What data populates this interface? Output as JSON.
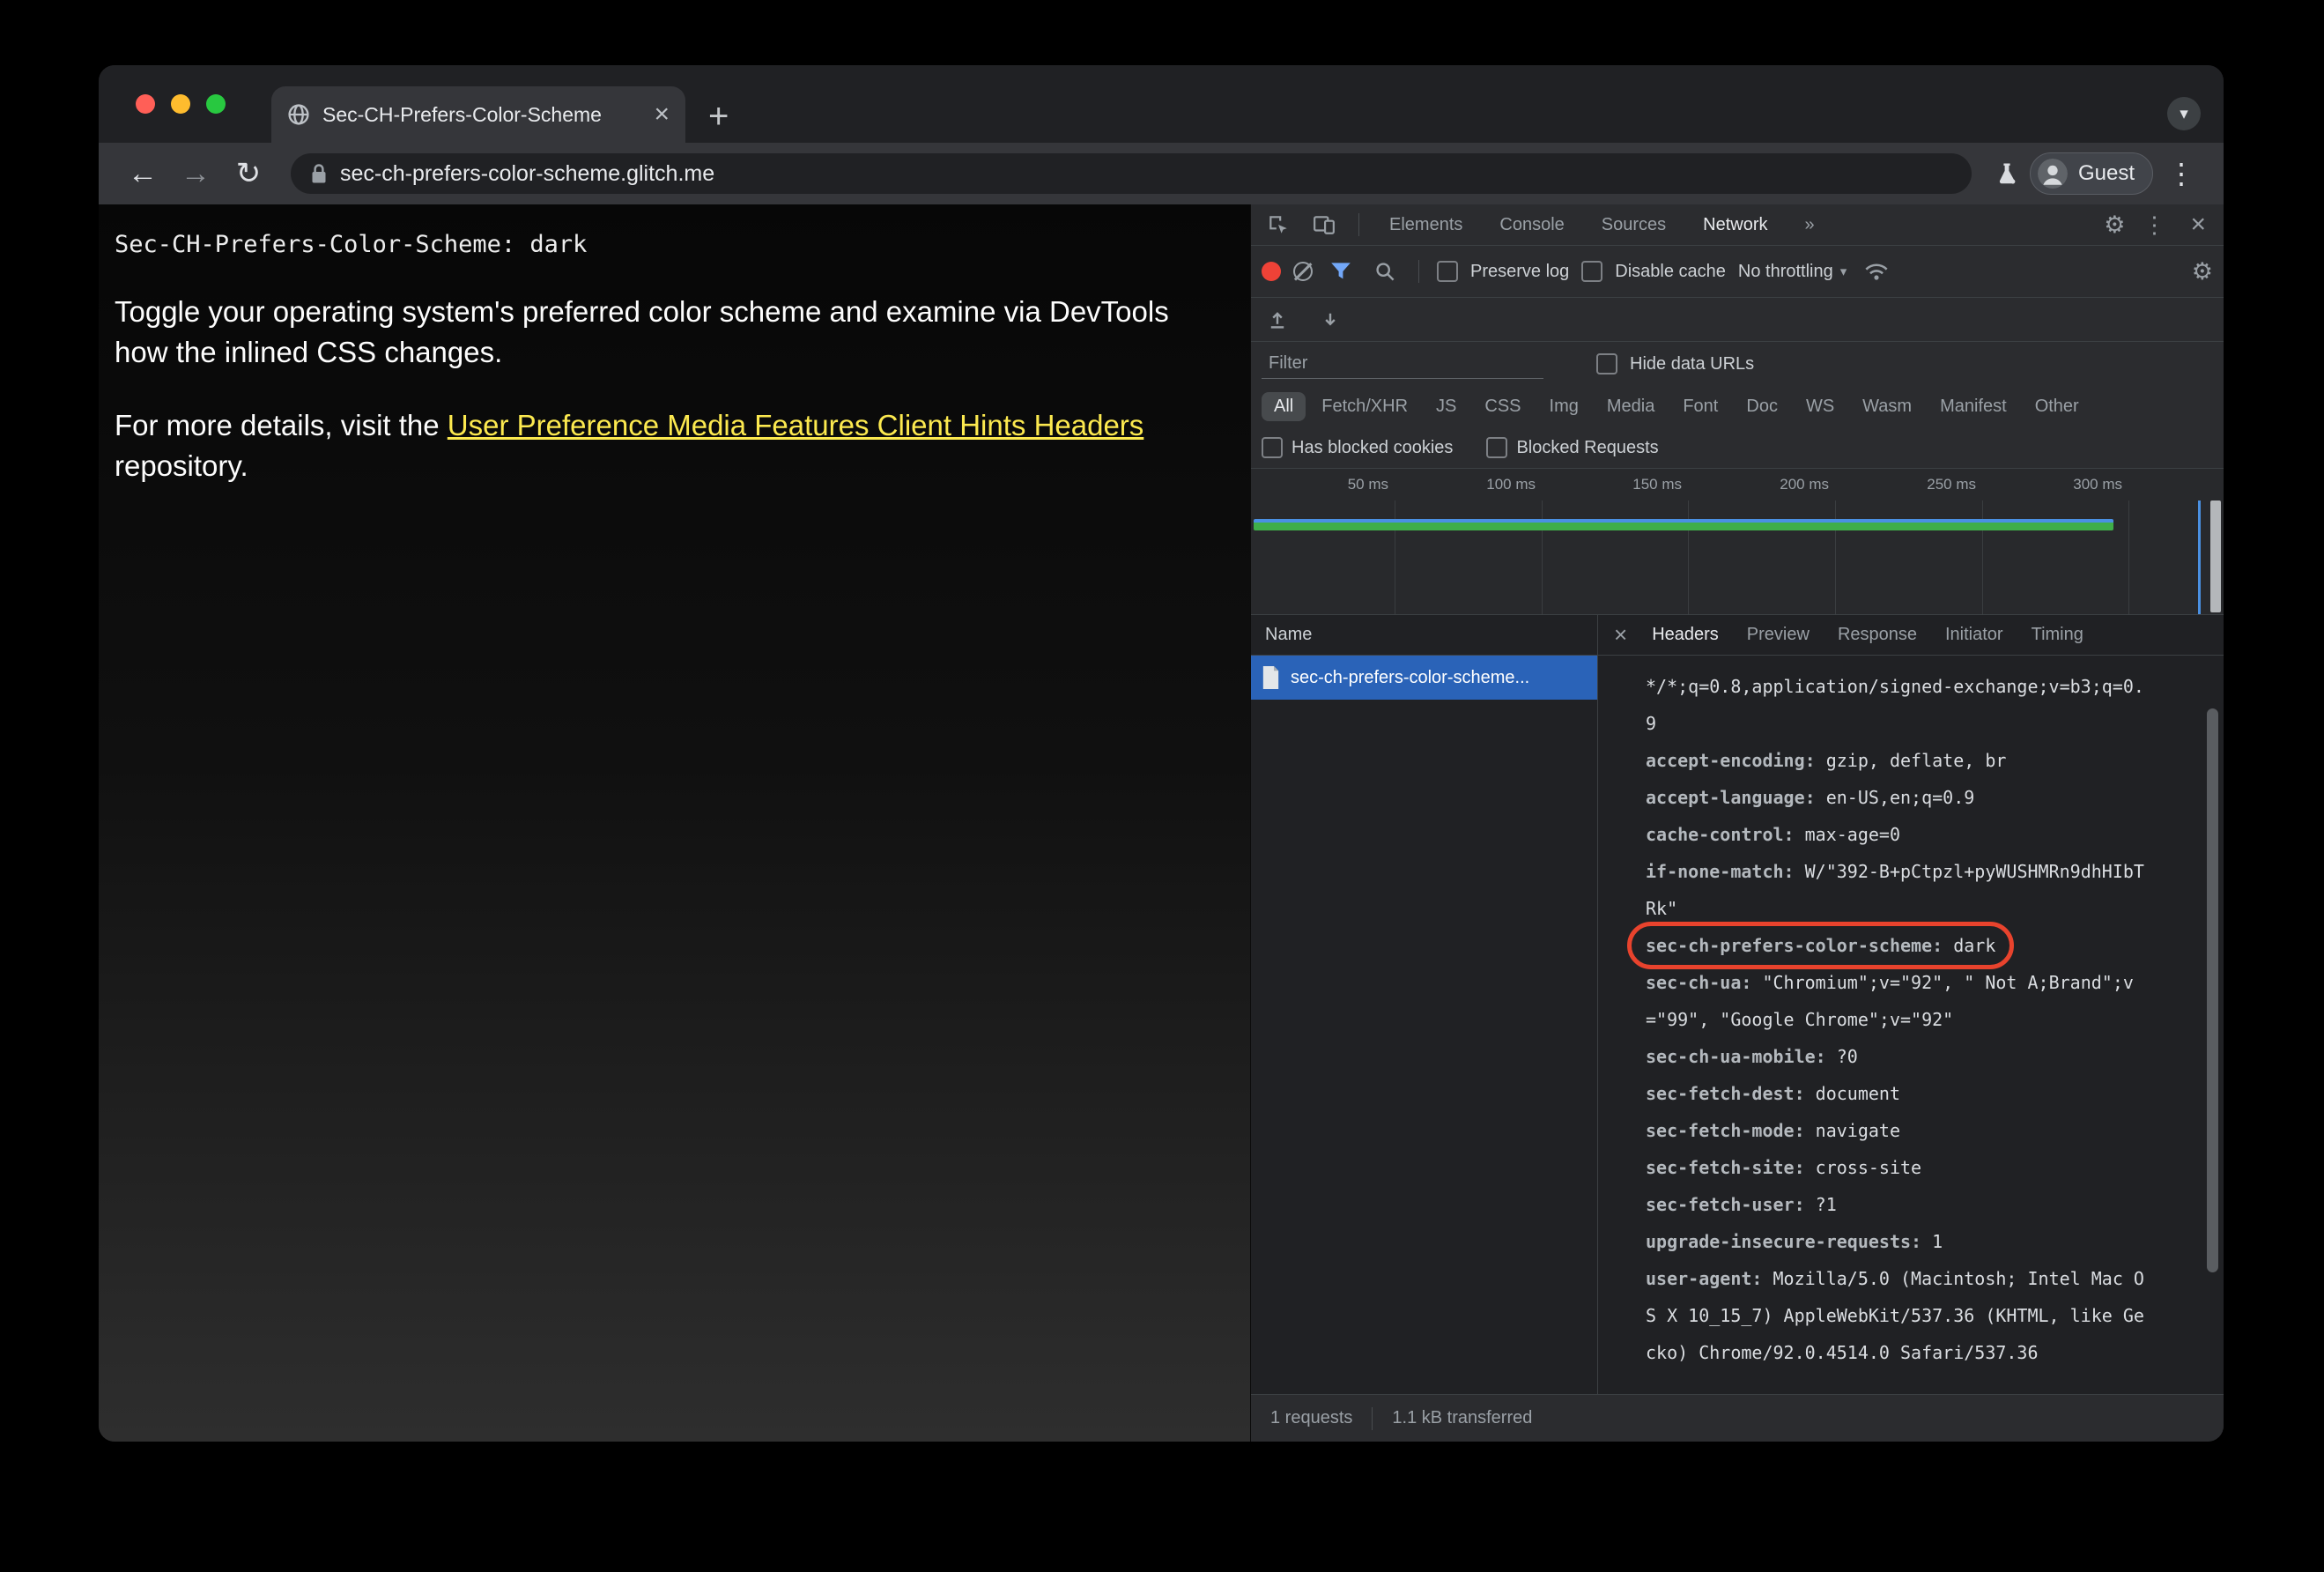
{
  "colors": {
    "accent_blue": "#8ab4f8",
    "record_red": "#ef4237",
    "annotation_red": "#e8432d",
    "link_yellow": "#fce94f",
    "selected_row_blue": "#2a63b8",
    "timeline_green": "#3fae49",
    "timeline_blue": "#4a90e2"
  },
  "browser": {
    "tab_title": "Sec-CH-Prefers-Color-Scheme",
    "tab_close": "×",
    "new_tab": "+",
    "tab_menu_chevron": "▾",
    "back": "←",
    "forward": "→",
    "reload": "↻",
    "url": "sec-ch-prefers-color-scheme.glitch.me",
    "guest_label": "Guest",
    "kebab": "⋮"
  },
  "page": {
    "mono_header": "Sec-CH-Prefers-Color-Scheme: dark",
    "para1": "Toggle your operating system's preferred color scheme and examine via DevTools how the inlined CSS changes.",
    "para2_prefix": "For more details, visit the ",
    "para2_link": "User Preference Media Features Client Hints Headers",
    "para2_suffix": " repository."
  },
  "devtools": {
    "tabs": [
      "Elements",
      "Console",
      "Sources",
      "Network"
    ],
    "overflow": "»",
    "gear": "⚙",
    "kebab": "⋮",
    "close": "×",
    "toolbar": {
      "preserve_log": "Preserve log",
      "disable_cache": "Disable cache",
      "throttling": "No throttling",
      "throttle_chevron": "▾"
    },
    "filter": {
      "placeholder": "Filter",
      "hide_data_urls": "Hide data URLs"
    },
    "chips": [
      "All",
      "Fetch/XHR",
      "JS",
      "CSS",
      "Img",
      "Media",
      "Font",
      "Doc",
      "WS",
      "Wasm",
      "Manifest",
      "Other"
    ],
    "blocked": {
      "cookies": "Has blocked cookies",
      "requests": "Blocked Requests"
    },
    "timeline_ticks": [
      "50 ms",
      "100 ms",
      "150 ms",
      "200 ms",
      "250 ms",
      "300 ms"
    ],
    "requests": {
      "name_header": "Name",
      "rows": [
        {
          "name": "sec-ch-prefers-color-scheme..."
        }
      ]
    },
    "details": {
      "close": "×",
      "tabs": [
        "Headers",
        "Preview",
        "Response",
        "Initiator",
        "Timing"
      ]
    },
    "headers_list": [
      {
        "name": "",
        "value": "*/*;q=0.8,application/signed-exchange;v=b3;q=0.9"
      },
      {
        "name": "accept-encoding:",
        "value": "gzip, deflate, br"
      },
      {
        "name": "accept-language:",
        "value": "en-US,en;q=0.9"
      },
      {
        "name": "cache-control:",
        "value": "max-age=0"
      },
      {
        "name": "if-none-match:",
        "value": "W/\"392-B+pCtpzl+pyWUSHMRn9dhHIbTRk\""
      },
      {
        "name": "sec-ch-prefers-color-scheme:",
        "value": "dark"
      },
      {
        "name": "sec-ch-ua:",
        "value": "\"Chromium\";v=\"92\", \" Not A;Brand\";v=\"99\", \"Google Chrome\";v=\"92\""
      },
      {
        "name": "sec-ch-ua-mobile:",
        "value": "?0"
      },
      {
        "name": "sec-fetch-dest:",
        "value": "document"
      },
      {
        "name": "sec-fetch-mode:",
        "value": "navigate"
      },
      {
        "name": "sec-fetch-site:",
        "value": "cross-site"
      },
      {
        "name": "sec-fetch-user:",
        "value": "?1"
      },
      {
        "name": "upgrade-insecure-requests:",
        "value": "1"
      },
      {
        "name": "user-agent:",
        "value": "Mozilla/5.0 (Macintosh; Intel Mac OS X 10_15_7) AppleWebKit/537.36 (KHTML, like Gecko) Chrome/92.0.4514.0 Safari/537.36"
      }
    ],
    "status": {
      "requests": "1 requests",
      "transferred": "1.1 kB transferred"
    }
  }
}
